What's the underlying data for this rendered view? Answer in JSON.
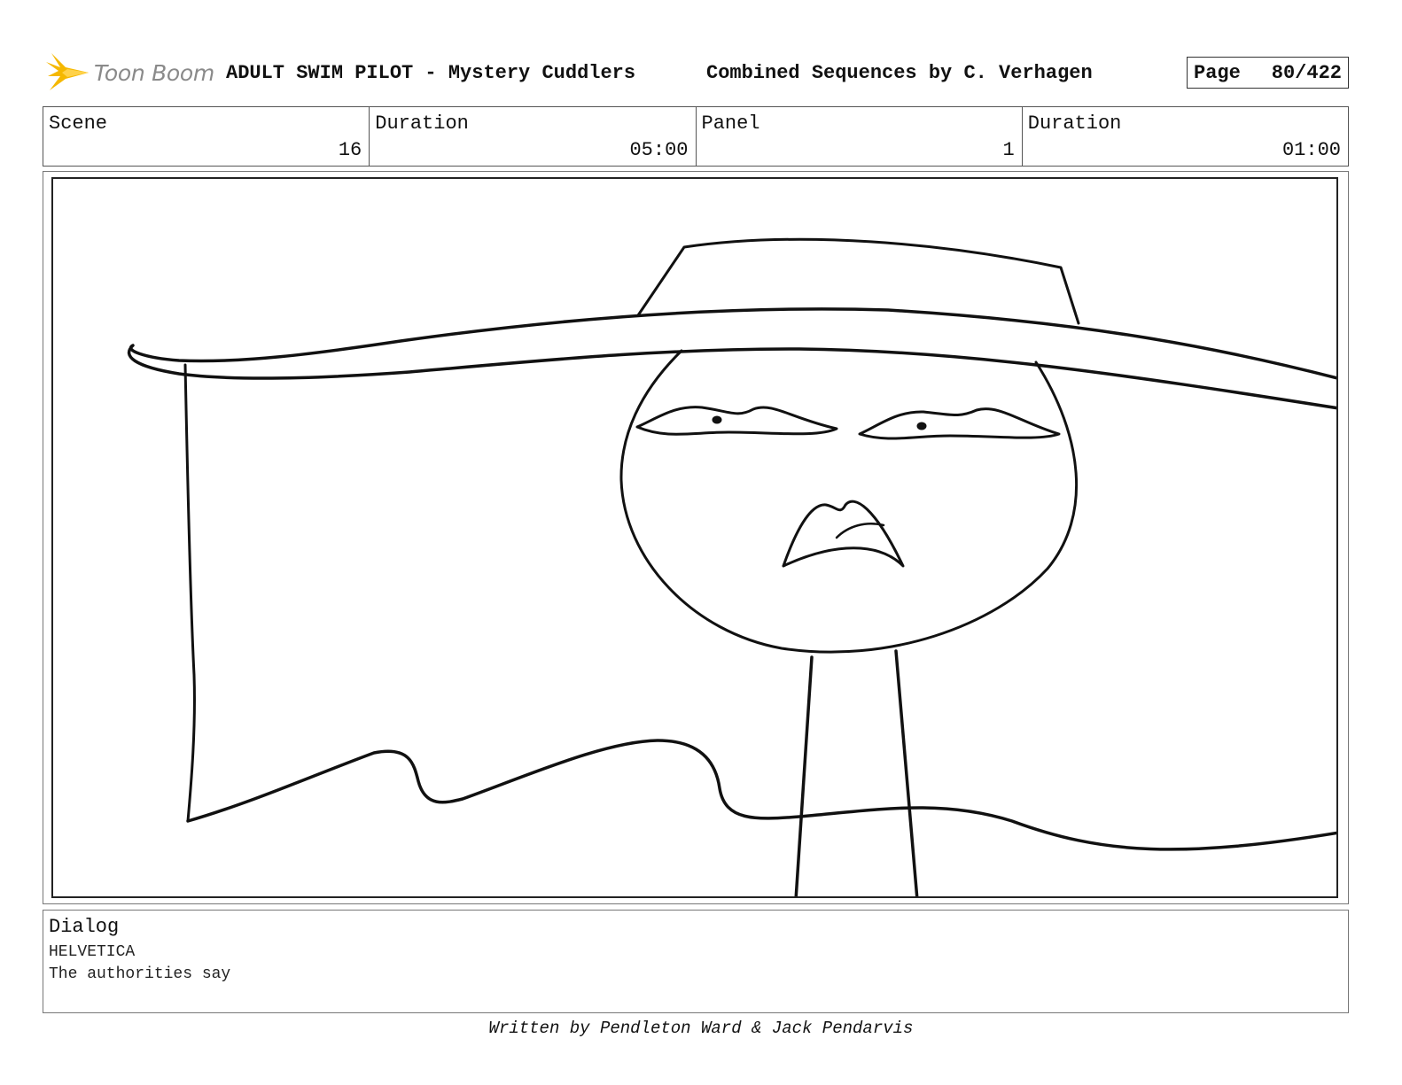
{
  "header": {
    "logo_text": "Toon Boom",
    "title": "ADULT SWIM PILOT - Mystery Cuddlers",
    "subtitle": "Combined Sequences by C. Verhagen",
    "page_label": "Page",
    "page_value": "80/422"
  },
  "info": {
    "scene_label": "Scene",
    "scene_value": "16",
    "duration_label": "Duration",
    "duration_value": "05:00",
    "panel_label": "Panel",
    "panel_value": "1",
    "panel_duration_label": "Duration",
    "panel_duration_value": "01:00"
  },
  "dialog": {
    "heading": "Dialog",
    "character": "HELVETICA",
    "line": "The authorities say"
  },
  "footer": {
    "credit": "Written by Pendleton Ward & Jack Pendarvis"
  },
  "colors": {
    "logo_accent": "#f5b800",
    "ink": "#111111"
  }
}
